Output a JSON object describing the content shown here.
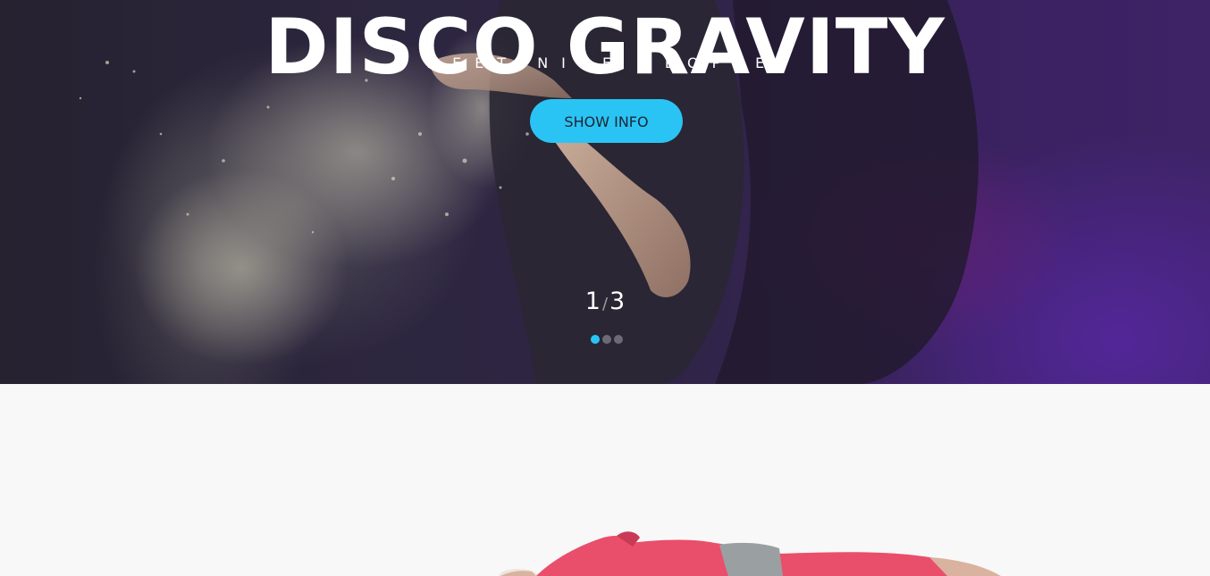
{
  "hero": {
    "title": "DISCO GRAVITY",
    "subtitle": "MEET NICE PEOPLE!",
    "button_label": "SHOW INFO",
    "slide_current": "1",
    "slide_separator": "/",
    "slide_total": "3",
    "slide_dots": [
      {
        "active": true
      },
      {
        "active": false
      },
      {
        "active": false
      }
    ],
    "background_image": "dancer with powder cloud on purple background"
  },
  "section": {
    "image": "woman in red top stretching on white background"
  },
  "colors": {
    "accent": "#2ac4f4",
    "hero_purple": "#3e2366",
    "page_background": "#f8f8f8"
  }
}
